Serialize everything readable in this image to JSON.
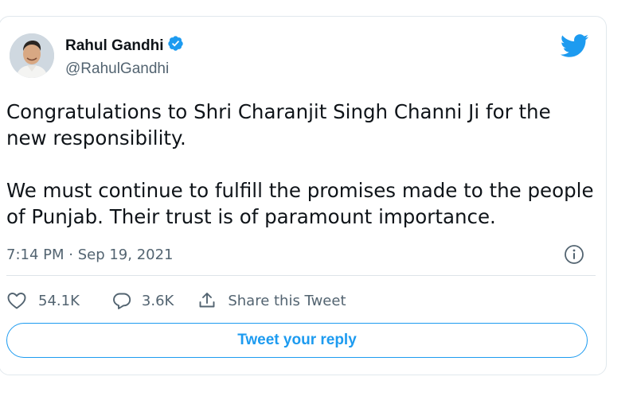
{
  "author": {
    "name": "Rahul Gandhi",
    "handle": "@RahulGandhi",
    "verified": true
  },
  "tweet": {
    "paragraphs": [
      "Congratulations to Shri Charanjit Singh Channi Ji for the new responsibility.",
      "We must continue to fulfill the promises made to the people of Punjab. Their trust is of paramount importance."
    ],
    "timestamp": "7:14 PM · Sep 19, 2021"
  },
  "actions": {
    "likes": "54.1K",
    "replies": "3.6K",
    "share_label": "Share this Tweet",
    "reply_button_label": "Tweet your reply"
  },
  "icons": {
    "logo": "twitter-bird-icon",
    "verified": "verified-badge-icon",
    "info": "info-icon",
    "like": "heart-icon",
    "reply": "reply-bubble-icon",
    "share": "share-icon"
  },
  "colors": {
    "accent": "#1d9bf0",
    "text": "#0f1419",
    "secondary_text": "#536471",
    "border": "#e1e8ed"
  }
}
